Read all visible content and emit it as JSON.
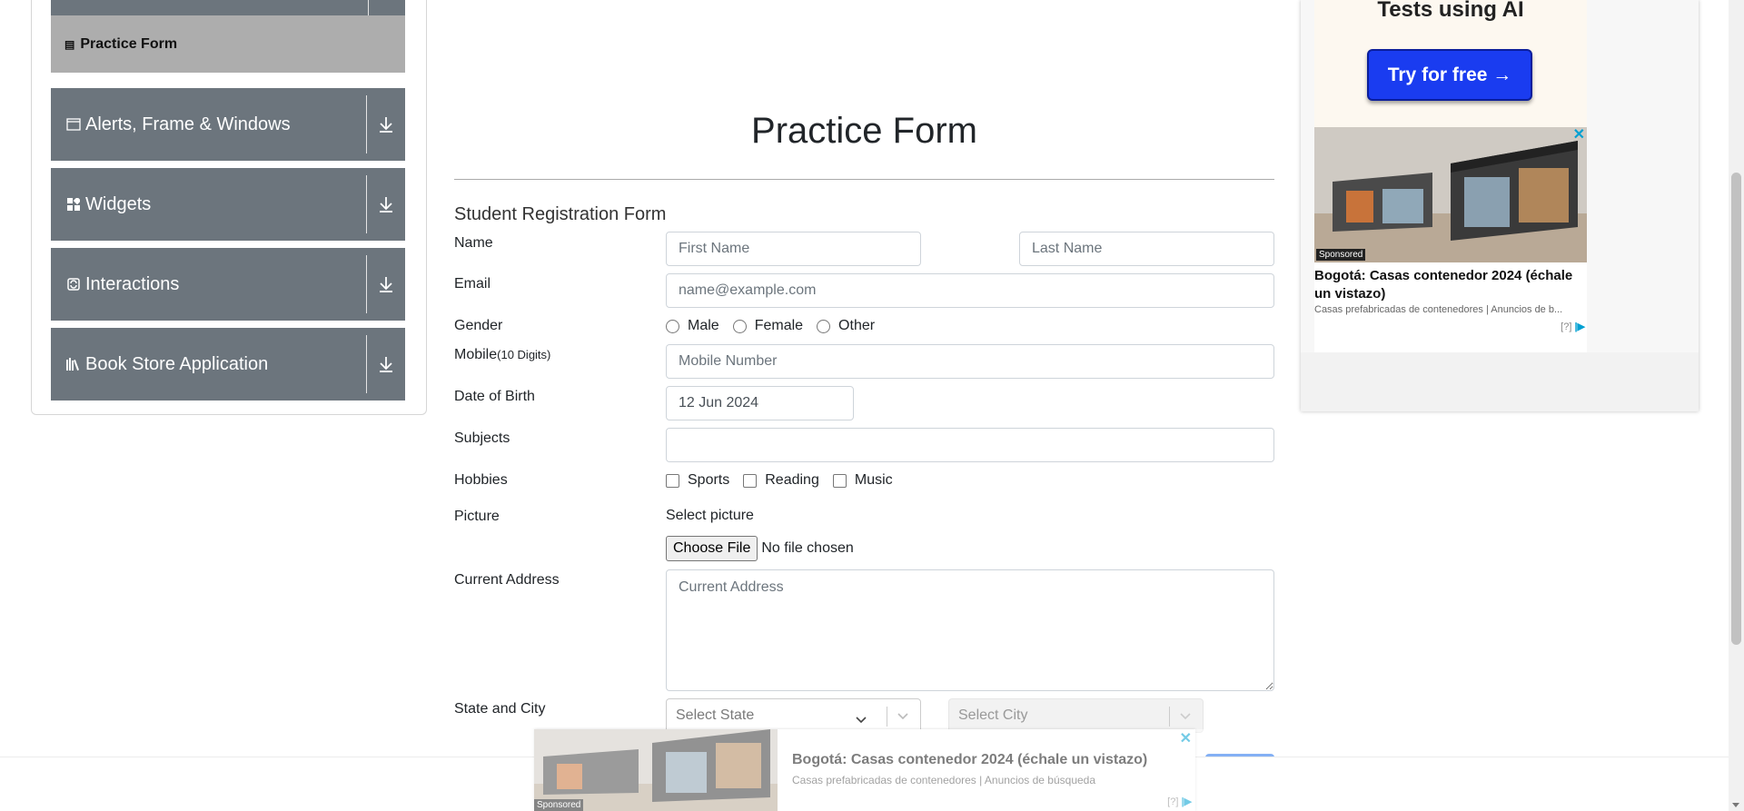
{
  "sidebar": {
    "active_item": "Practice Form",
    "groups": [
      {
        "label": "Alerts, Frame & Windows",
        "icon": "window-icon"
      },
      {
        "label": "Widgets",
        "icon": "widgets-icon"
      },
      {
        "label": "Interactions",
        "icon": "interactions-icon"
      },
      {
        "label": "Book Store Application",
        "icon": "books-icon"
      }
    ]
  },
  "form": {
    "title": "Practice Form",
    "subtitle": "Student Registration Form",
    "name_label": "Name",
    "first_name_placeholder": "First Name",
    "last_name_placeholder": "Last Name",
    "email_label": "Email",
    "email_placeholder": "name@example.com",
    "gender_label": "Gender",
    "gender_options": [
      "Male",
      "Female",
      "Other"
    ],
    "mobile_label": "Mobile",
    "mobile_hint": "(10 Digits)",
    "mobile_placeholder": "Mobile Number",
    "dob_label": "Date of Birth",
    "dob_value": "12 Jun 2024",
    "subjects_label": "Subjects",
    "hobbies_label": "Hobbies",
    "hobby_options": [
      "Sports",
      "Reading",
      "Music"
    ],
    "picture_label": "Picture",
    "select_picture": "Select picture",
    "choose_file": "Choose File",
    "no_file": "No file chosen",
    "address_label": "Current Address",
    "address_placeholder": "Current Address",
    "state_city_label": "State and City",
    "state_placeholder": "Select State",
    "city_placeholder": "Select City"
  },
  "ad_right": {
    "top_text": "Tests using AI",
    "button": "Try for free →",
    "sponsored": "Sponsored",
    "headline": "Bogotá: Casas contenedor 2024 (échale un vistazo)",
    "description": "Casas prefabricadas de contenedores | Anuncios de b...",
    "help": "[?]",
    "close": "✕"
  },
  "ad_bottom": {
    "sponsored": "Sponsored",
    "headline": "Bogotá: Casas contenedor 2024 (échale un vistazo)",
    "description": "Casas prefabricadas de contenedores | Anuncios de búsqueda",
    "help": "[?]",
    "close": "✕"
  },
  "colors": {
    "sidebar_group": "#6c757d",
    "active_item": "#adadad",
    "ad_button": "#1a3cf0",
    "ad_accent": "#00a0d2"
  }
}
